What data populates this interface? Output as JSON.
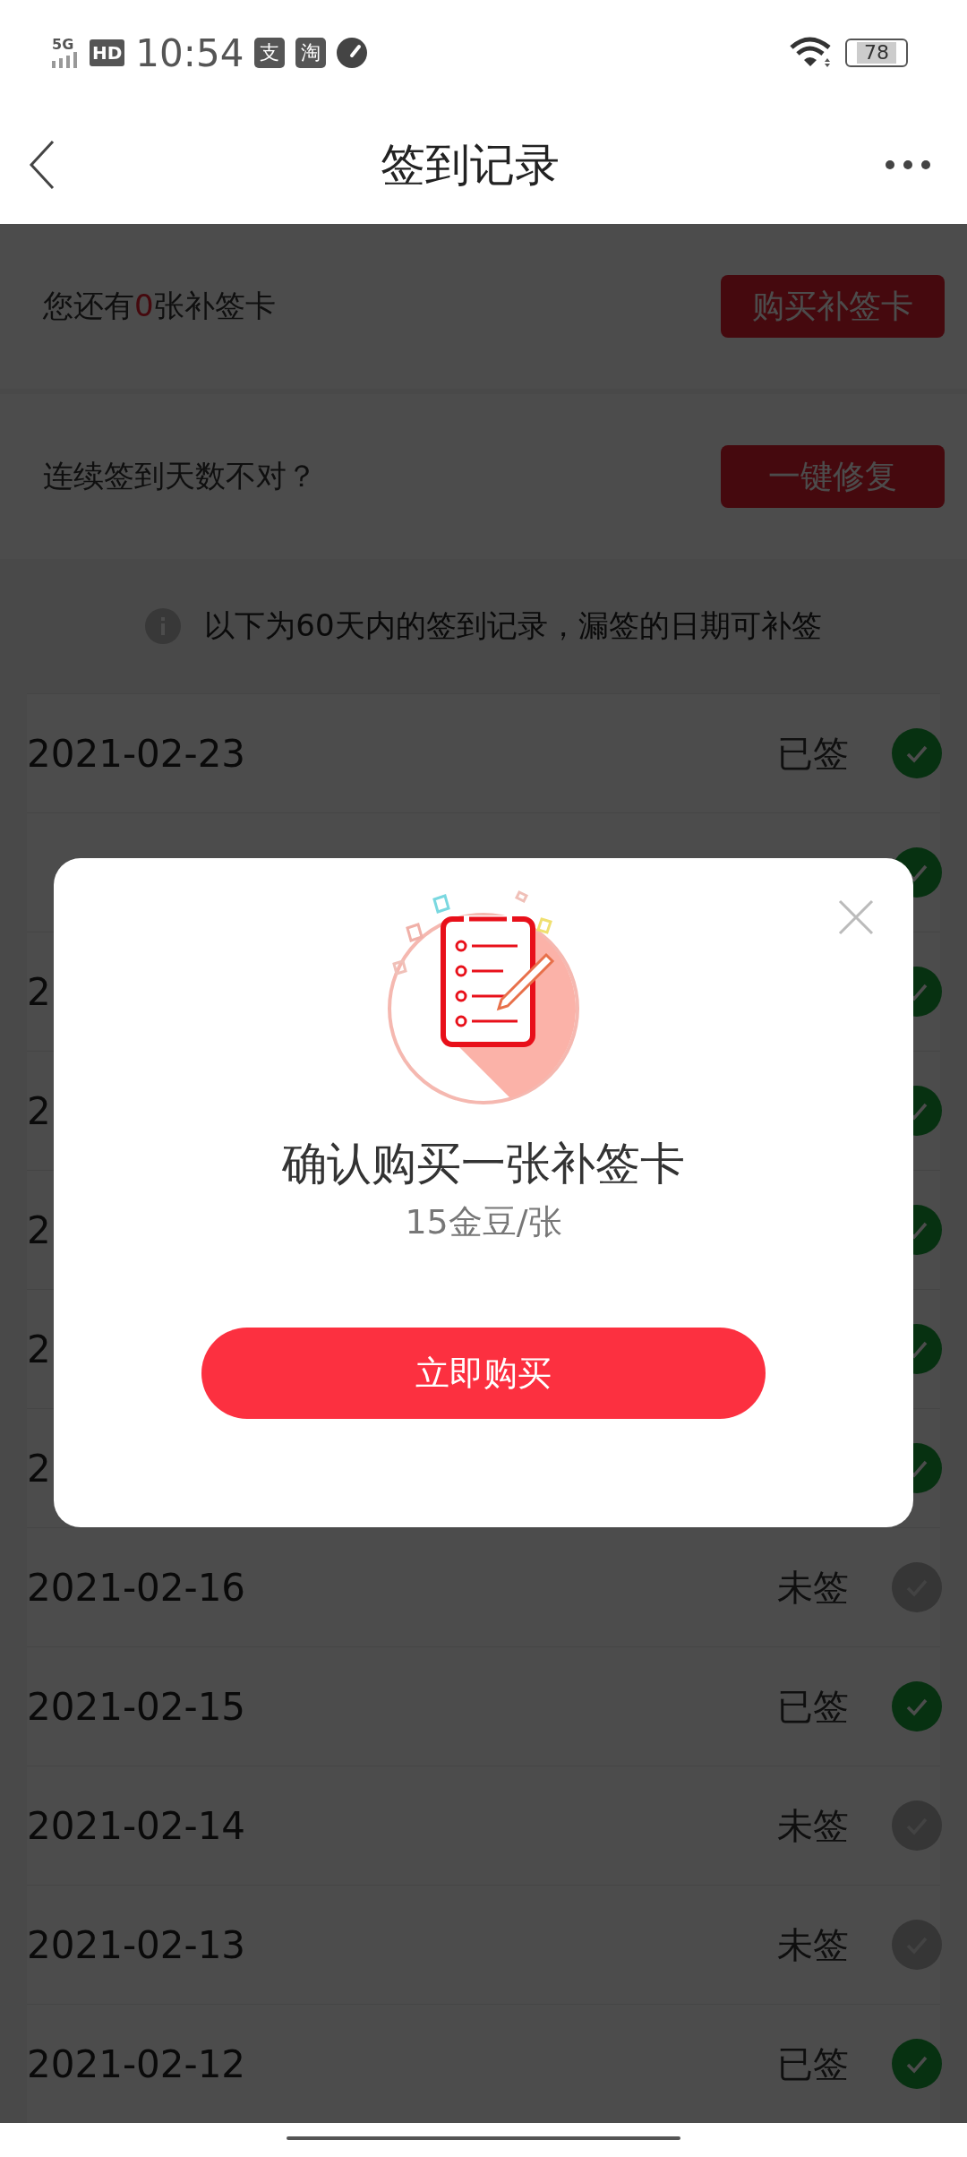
{
  "status_bar": {
    "network": "5G",
    "hd": "HD",
    "time": "10:54",
    "notification_icons": [
      "支",
      "淘"
    ],
    "battery": "78"
  },
  "header": {
    "title": "签到记录"
  },
  "card_balance": {
    "text_before": "您还有",
    "count": "0",
    "text_after": "张补签卡",
    "button": "购买补签卡"
  },
  "card_repair": {
    "text": "连续签到天数不对？",
    "button": "一键修复"
  },
  "notice": "以下为60天内的签到记录，漏签的日期可补签",
  "records": [
    {
      "date": "2021-02-23",
      "status": "已签",
      "signed": true
    },
    {
      "signed": true
    },
    {
      "date": "2",
      "signed": true
    },
    {
      "date": "2",
      "signed": true
    },
    {
      "date": "2",
      "signed": true
    },
    {
      "date": "2",
      "signed": true
    },
    {
      "date": "2",
      "signed": true
    },
    {
      "date": "2021-02-16",
      "status": "未签",
      "signed": false
    },
    {
      "date": "2021-02-15",
      "status": "已签",
      "signed": true
    },
    {
      "date": "2021-02-14",
      "status": "未签",
      "signed": false
    },
    {
      "date": "2021-02-13",
      "status": "未签",
      "signed": false
    },
    {
      "date": "2021-02-12",
      "status": "已签",
      "signed": true
    }
  ],
  "dialog": {
    "title": "确认购买一张补签卡",
    "price": "15金豆/张",
    "button": "立即购买"
  }
}
